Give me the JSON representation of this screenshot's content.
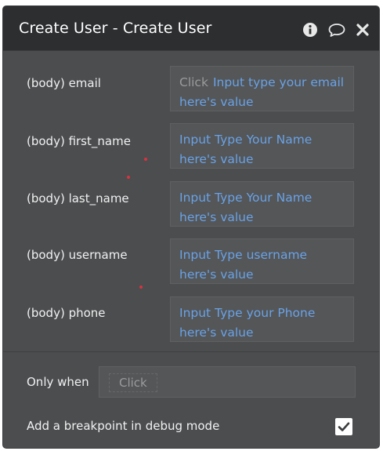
{
  "header": {
    "title": "Create User - Create User",
    "icons": [
      "info-icon",
      "comment-icon",
      "close-icon"
    ]
  },
  "fields": [
    {
      "label": "(body) email",
      "click_hint": "Click",
      "value": "Input type your email here's value"
    },
    {
      "label": "(body) first_name",
      "click_hint": "",
      "value": "Input Type Your Name here's value"
    },
    {
      "label": "(body) last_name",
      "click_hint": "",
      "value": "Input Type Your Name here's value"
    },
    {
      "label": "(body) username",
      "click_hint": "",
      "value": "Input Type username here's value"
    },
    {
      "label": "(body) phone",
      "click_hint": "",
      "value": "Input Type your Phone here's value"
    }
  ],
  "condition": {
    "label": "Only when",
    "placeholder": "Click"
  },
  "breakpoint": {
    "label": "Add a breakpoint in debug mode",
    "checked": true
  },
  "colors": {
    "panel": "#4b4d4f",
    "header": "#2c2e30",
    "dynamic_value": "#6aa2e6",
    "required_marker": "#d9333f"
  }
}
